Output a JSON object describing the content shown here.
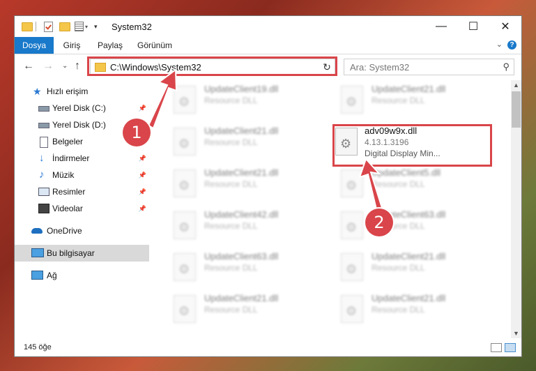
{
  "window": {
    "title": "System32",
    "min_label": "—",
    "max_label": "☐",
    "close_label": "✕"
  },
  "ribbon": {
    "tabs": [
      "Dosya",
      "Giriş",
      "Paylaş",
      "Görünüm"
    ],
    "collapse_label": "⌄",
    "help_label": "?"
  },
  "nav": {
    "back": "←",
    "forward": "→",
    "recent": "⌄",
    "up": "↑",
    "address": "C:\\Windows\\System32",
    "address_dropdown": "⌄",
    "refresh": "↻",
    "search_placeholder": "Ara: System32",
    "search_icon": "⚲"
  },
  "sidebar": {
    "items": [
      {
        "label": "Hızlı erişim",
        "icon": "star-icon",
        "pin": ""
      },
      {
        "label": "Yerel Disk (C:)",
        "icon": "drive-icon",
        "pin": "📌"
      },
      {
        "label": "Yerel Disk (D:)",
        "icon": "drive-icon",
        "pin": ""
      },
      {
        "label": "Belgeler",
        "icon": "documents-icon",
        "pin": ""
      },
      {
        "label": "İndirmeler",
        "icon": "download-icon",
        "pin": "📌"
      },
      {
        "label": "Müzik",
        "icon": "music-icon",
        "pin": "📌"
      },
      {
        "label": "Resimler",
        "icon": "pictures-icon",
        "pin": "📌"
      },
      {
        "label": "Videolar",
        "icon": "videos-icon",
        "pin": "📌"
      },
      {
        "label": "OneDrive",
        "icon": "cloud-icon",
        "pin": ""
      },
      {
        "label": "Bu bilgisayar",
        "icon": "computer-icon",
        "pin": ""
      },
      {
        "label": "Ağ",
        "icon": "network-icon",
        "pin": ""
      }
    ]
  },
  "files": {
    "col1": [
      {
        "name": "UpdateClient19.dll",
        "type": "Resource DLL"
      },
      {
        "name": "UpdateClient21.dll",
        "type": "Resource DLL"
      },
      {
        "name": "UpdateClient21.dll",
        "type": "Resource DLL"
      },
      {
        "name": "UpdateClient42.dll",
        "type": "Resource DLL"
      },
      {
        "name": "UpdateClient63.dll",
        "type": "Resource DLL"
      },
      {
        "name": "UpdateClient21.dll",
        "type": "Resource DLL"
      }
    ],
    "col2": [
      {
        "name": "UpdateClient21.dll",
        "type": "Resource DLL"
      },
      {
        "name": "UpdateClient5.dll",
        "type": "Resource DLL"
      },
      {
        "name": "UpdateClient63.dll",
        "type": "Resource DLL"
      },
      {
        "name": "UpdateClient21.dll",
        "type": "Resource DLL"
      },
      {
        "name": "UpdateClient21.dll",
        "type": "Resource DLL"
      }
    ],
    "highlighted": {
      "name": "adv09w9x.dll",
      "version": "4.13.1.3196",
      "description": "Digital Display Min..."
    }
  },
  "status": {
    "count": "145 öğe"
  },
  "annotations": {
    "step1": "1",
    "step2": "2",
    "color": "#d9454a"
  }
}
